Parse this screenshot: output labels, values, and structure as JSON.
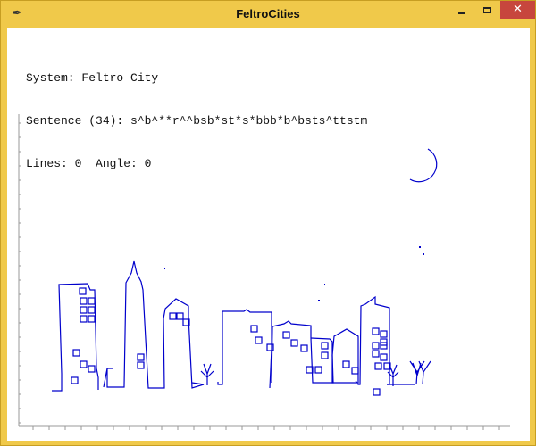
{
  "window": {
    "title": "FeltroCities",
    "icon": "feather-icon",
    "colors": {
      "frame": "#f0c94a",
      "close": "#c7463d",
      "drawing": "#0000cc"
    }
  },
  "info": {
    "system_line": "System: Feltro City",
    "sentence_line": "Sentence (34): s^b^**r^^bsb*st*s*bbb*b^bsts^ttstm",
    "stats_line": "Lines: 0  Angle: 0"
  }
}
